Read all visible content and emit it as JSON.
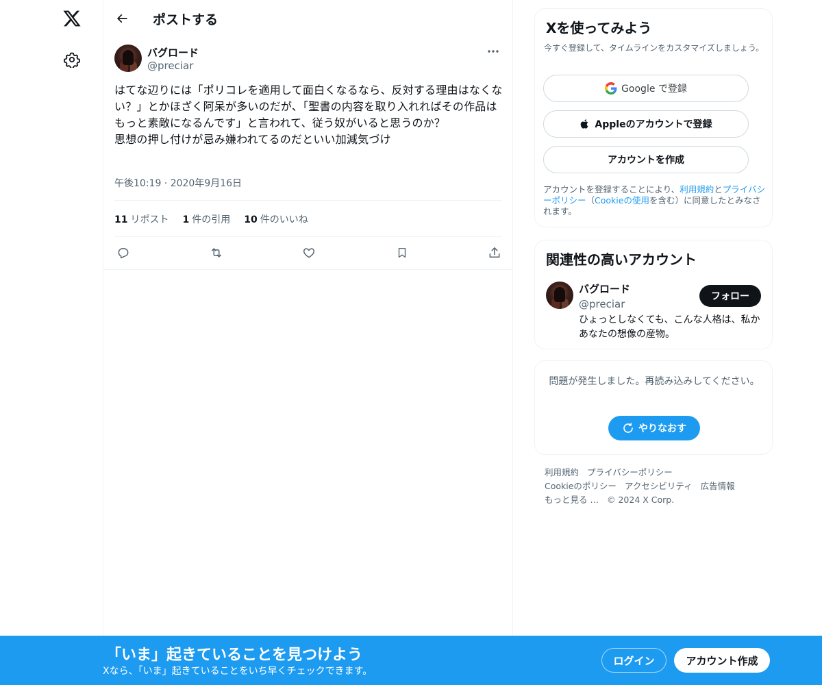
{
  "rail": {
    "logo_icon": "x-logo-icon",
    "settings_icon": "gear-icon"
  },
  "header": {
    "title": "ポストする"
  },
  "post": {
    "author_name": "バグロード",
    "author_handle": "@preciar",
    "text": "はてな辺りには「ポリコレを適用して面白くなるなら、反対する理由はなくない？」とかほざく阿呆が多いのだが、「聖書の内容を取り入れればその作品はもっと素敵になるんです」と言われて、従う奴がいると思うのか？\n思想の押し付けが忌み嫌われてるのだといい加減気づけ",
    "timestamp": "午後10:19 · 2020年9月16日",
    "stats": {
      "reposts_count": "11",
      "reposts_label": "リポスト",
      "quotes_count": "1",
      "quotes_label": "件の引用",
      "likes_count": "10",
      "likes_label": "件のいいね"
    }
  },
  "signup": {
    "title": "Xを使ってみよう",
    "subtitle": "今すぐ登録して、タイムラインをカスタマイズしましょう。",
    "google_label": "Google で登録",
    "apple_label": "Appleのアカウントで登録",
    "create_label": "アカウントを作成",
    "legal_prefix": "アカウントを登録することにより、",
    "legal_terms": "利用規約",
    "legal_and": "と",
    "legal_privacy": "プライバシーポリシー",
    "legal_open": "（",
    "legal_cookie": "Cookieの使用",
    "legal_suffix": "を含む）に同意したとみなされます。"
  },
  "related": {
    "title": "関連性の高いアカウント",
    "name": "バグロード",
    "handle": "@preciar",
    "bio": "ひょっとしなくても、こんな人格は、私かあなたの想像の産物。",
    "follow_label": "フォロー"
  },
  "error": {
    "message": "問題が発生しました。再読み込みしてください。",
    "retry_label": "やりなおす"
  },
  "footer": {
    "terms": "利用規約",
    "privacy": "プライバシーポリシー",
    "cookie": "Cookieのポリシー",
    "accessibility": "アクセシビリティ",
    "ads": "広告情報",
    "more": "もっと見る …",
    "copyright": "© 2024 X Corp."
  },
  "banner": {
    "headline": "「いま」起きていることを見つけよう",
    "subline": "Xなら、「いま」起きていることをいち早くチェックできます。",
    "login_label": "ログイン",
    "create_label": "アカウント作成"
  },
  "colors": {
    "accent": "#1d9bf0",
    "text": "#0f1419",
    "muted": "#536471",
    "border": "#eff3f4"
  }
}
